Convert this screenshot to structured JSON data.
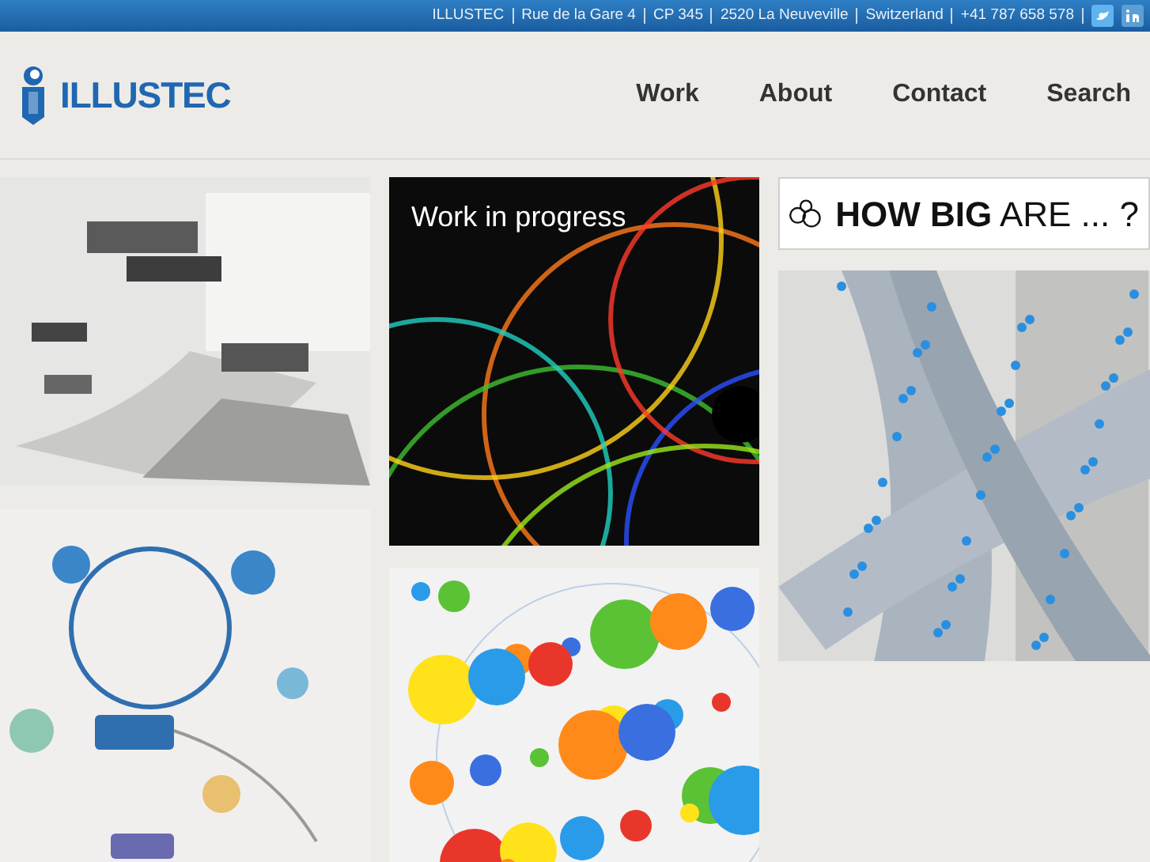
{
  "top_bar": {
    "items": [
      "ILLUSTEC",
      "Rue de la Gare 4",
      "CP 345",
      "2520 La Neuveville",
      "Switzerland",
      "+41 787 658 578"
    ]
  },
  "header": {
    "logo": "ILLUSTEC",
    "nav": [
      {
        "label": "Work"
      },
      {
        "label": "About"
      },
      {
        "label": "Contact"
      },
      {
        "label": "Search"
      }
    ]
  },
  "tiles": {
    "featured": {
      "caption": "Work in progress"
    },
    "banner": {
      "title": "**HOW BIG** ARE ... ?"
    }
  }
}
